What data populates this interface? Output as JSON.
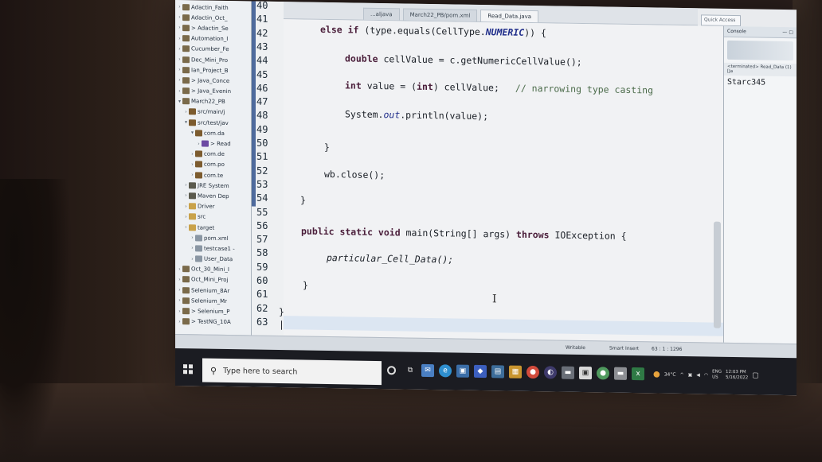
{
  "editor_tabs": [
    "...aljava",
    "March22_PB/pom.xml",
    "Read_Data.java"
  ],
  "active_tab_index": 2,
  "quick_access": "Quick Access",
  "explorer": {
    "items": [
      {
        "label": "Adactin_Faith",
        "indent": 0,
        "icon": "project-icon"
      },
      {
        "label": "Adactin_Oct_",
        "indent": 0,
        "icon": "project-icon"
      },
      {
        "label": "> Adactin_Se",
        "indent": 0,
        "icon": "project-icon"
      },
      {
        "label": "Automation_I",
        "indent": 0,
        "icon": "project-icon"
      },
      {
        "label": "Cucumber_Fe",
        "indent": 0,
        "icon": "project-icon"
      },
      {
        "label": "Dec_Mini_Pro",
        "indent": 0,
        "icon": "project-icon"
      },
      {
        "label": "Ian_Project_B",
        "indent": 0,
        "icon": "project-icon"
      },
      {
        "label": "> Java_Conce",
        "indent": 0,
        "icon": "project-icon"
      },
      {
        "label": "> Java_Evenin",
        "indent": 0,
        "icon": "project-icon"
      },
      {
        "label": "March22_PB",
        "indent": 0,
        "icon": "project-icon",
        "expanded": true
      },
      {
        "label": "src/main/j",
        "indent": 1,
        "icon": "package-icon"
      },
      {
        "label": "src/test/jav",
        "indent": 1,
        "icon": "package-icon",
        "expanded": true
      },
      {
        "label": "com.da",
        "indent": 2,
        "icon": "package-icon",
        "expanded": true
      },
      {
        "label": "> Read",
        "indent": 3,
        "icon": "java-file-icon"
      },
      {
        "label": "com.de",
        "indent": 2,
        "icon": "package-icon"
      },
      {
        "label": "com.po",
        "indent": 2,
        "icon": "package-icon"
      },
      {
        "label": "com.te",
        "indent": 2,
        "icon": "package-icon"
      },
      {
        "label": "JRE System",
        "indent": 1,
        "icon": "library-icon"
      },
      {
        "label": "Maven Dep",
        "indent": 1,
        "icon": "library-icon"
      },
      {
        "label": "Driver",
        "indent": 1,
        "icon": "folder-icon"
      },
      {
        "label": "src",
        "indent": 1,
        "icon": "folder-icon"
      },
      {
        "label": "target",
        "indent": 1,
        "icon": "folder-icon"
      },
      {
        "label": "pom.xml",
        "indent": 2,
        "icon": "file-icon"
      },
      {
        "label": "testcase1 -",
        "indent": 2,
        "icon": "file-icon"
      },
      {
        "label": "User_Data",
        "indent": 2,
        "icon": "file-icon"
      },
      {
        "label": "Oct_30_Mini_I",
        "indent": 0,
        "icon": "project-icon"
      },
      {
        "label": "Oct_Mini_Proj",
        "indent": 0,
        "icon": "project-icon"
      },
      {
        "label": "Selenium_8Ar",
        "indent": 0,
        "icon": "project-icon"
      },
      {
        "label": "Selenium_Mr",
        "indent": 0,
        "icon": "project-icon"
      },
      {
        "label": "> Selenium_P",
        "indent": 0,
        "icon": "project-icon"
      },
      {
        "label": "> TestNG_10A",
        "indent": 0,
        "icon": "project-icon"
      }
    ],
    "scroll_left": "<",
    "scroll_right": ">"
  },
  "line_numbers": [
    "40",
    "41",
    "42",
    "43",
    "44",
    "45",
    "46",
    "47",
    "48",
    "49",
    "50",
    "51",
    "52",
    "53",
    "54",
    "55",
    "56",
    "57",
    "58",
    "59",
    "60",
    "61",
    "62",
    "63"
  ],
  "code": {
    "l42_kw": "else if",
    "l42_rest": " (type.equals(CellType.",
    "l42_const": "NUMERIC",
    "l42_end": ")) {",
    "l44_kw": "double",
    "l44_rest": " cellValue = c.getNumericCellValue();",
    "l46_kw": "int",
    "l46_rest": " value = (",
    "l46_kw2": "int",
    "l46_rest2": ") cellValue;",
    "l46_comment": "// narrowing type casting",
    "l48_pre": "System.",
    "l48_field": "out",
    "l48_post": ".println(value);",
    "l50": "}",
    "l52": "wb.close();",
    "l54": "}",
    "l56_kw": "public static void",
    "l56_rest": " main(String[] args) ",
    "l56_kw2": "throws",
    "l56_rest2": " IOException {",
    "l58": "particular_Cell_Data();",
    "l60": "}",
    "l62": "}",
    "l63": "|"
  },
  "console": {
    "tab": "Console",
    "terminated": "<terminated> Read_Data (1) [Ja",
    "output": "Starc345"
  },
  "statusbar": {
    "writable": "Writable",
    "insert_mode": "Smart Insert",
    "position": "63 : 1 : 1296"
  },
  "taskbar": {
    "search_placeholder": "Type here to search",
    "weather": "34°C",
    "lang": "ENG",
    "region": "US",
    "time": "12:03 PM",
    "date": "5/16/2022"
  }
}
